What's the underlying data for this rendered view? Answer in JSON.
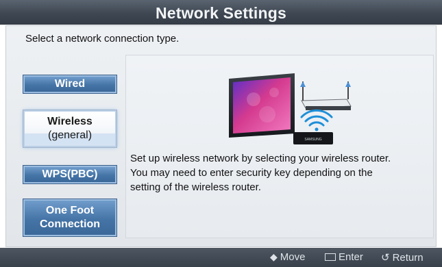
{
  "header": {
    "title": "Network Settings"
  },
  "instruction": "Select a network connection type.",
  "options": [
    {
      "label": "Wired",
      "selected": false
    },
    {
      "label_line1": "Wireless",
      "label_line2": "(general)",
      "selected": true
    },
    {
      "label": "WPS(PBC)",
      "selected": false
    },
    {
      "label_line1": "One Foot",
      "label_line2": "Connection",
      "selected": false
    }
  ],
  "illustration": {
    "router_badge": "SAMSUNG"
  },
  "description": {
    "line1": "Set up wireless network by selecting your wireless router.",
    "line2": "You may need to enter security key depending on the",
    "line3": "setting of the wireless router."
  },
  "footer": {
    "move_label": "Move",
    "enter_label": "Enter",
    "return_label": "Return"
  },
  "colors": {
    "option_blue": "#4574a6",
    "selected_bg": "#f4f7fa",
    "title_bar": "#3e4752"
  }
}
